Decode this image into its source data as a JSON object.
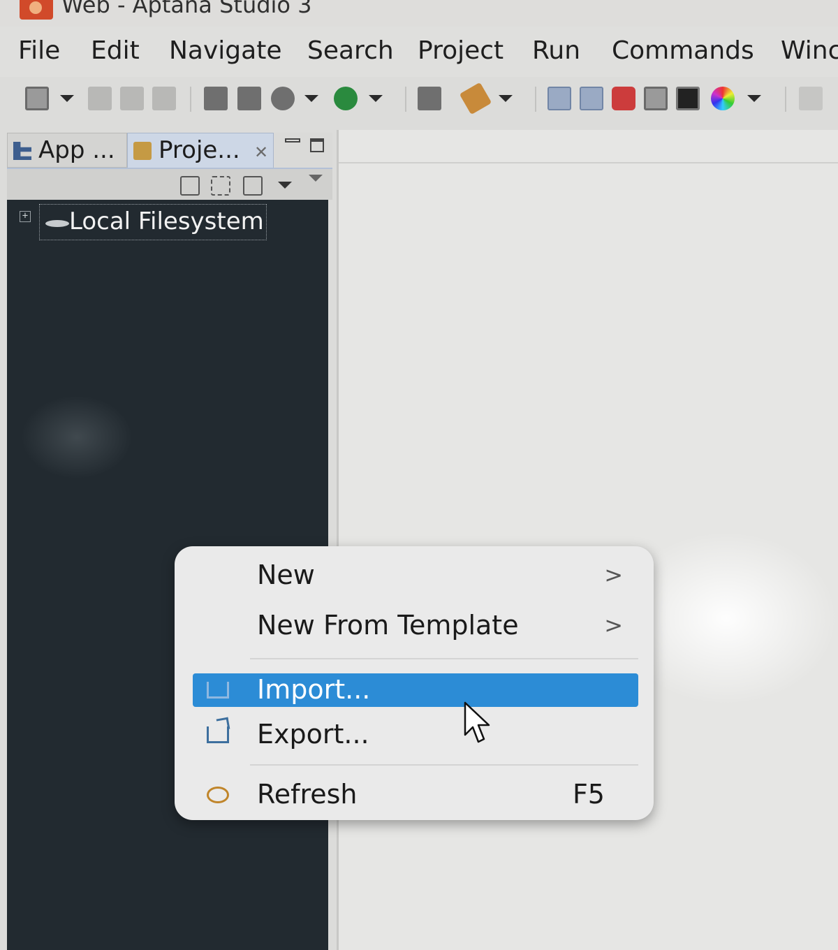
{
  "window": {
    "title": "Web - Aptana Studio 3"
  },
  "menubar": {
    "items": [
      "File",
      "Edit",
      "Navigate",
      "Search",
      "Project",
      "Run",
      "Commands",
      "Winc"
    ]
  },
  "toolbar": {
    "icons": [
      "new-icon",
      "save-icon",
      "save-all-icon",
      "print-icon",
      "run-config-icon",
      "debug-icon",
      "run-icon",
      "deploy-icon",
      "rocket-icon",
      "app-explorer-icon",
      "project-explorer-icon",
      "browser-icon",
      "window-icon",
      "terminal-icon",
      "theme-color-icon"
    ],
    "accent": "#2a8a3e"
  },
  "left_panel": {
    "tabs": [
      {
        "label": "App ...",
        "active": false
      },
      {
        "label": "Proje...",
        "active": true
      }
    ],
    "tree": {
      "nodes": [
        {
          "label": "Local Filesystem",
          "expanded": false
        }
      ]
    }
  },
  "context_menu": {
    "selected_color": "#2c8cd6",
    "items": [
      {
        "label": "New",
        "submenu": true,
        "submenu_arrow": ">"
      },
      {
        "label": "New From Template",
        "submenu": true,
        "submenu_arrow": ">"
      },
      {
        "label": "Import...",
        "selected": true
      },
      {
        "label": "Export..."
      },
      {
        "label": "Refresh",
        "shortcut": "F5"
      }
    ]
  },
  "theme": {
    "tree_background": "#222a30",
    "menu_background": "#eaeaea",
    "window_background": "#dcdcda"
  }
}
